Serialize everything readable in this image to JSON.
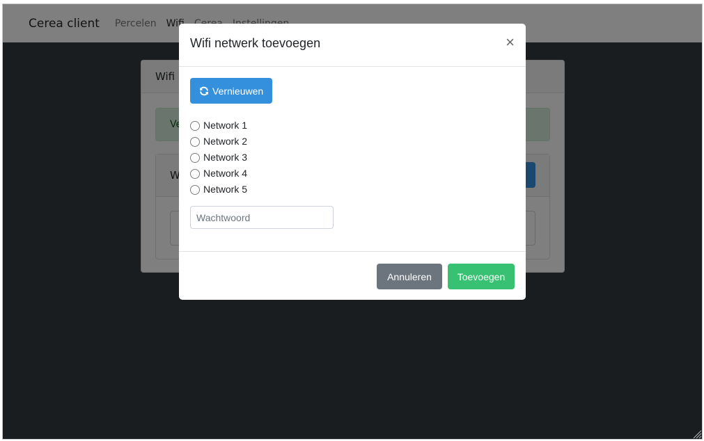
{
  "navbar": {
    "brand": "Cerea client",
    "links": [
      "Percelen",
      "Wifi",
      "Cerea",
      "Instellingen"
    ]
  },
  "background_page": {
    "card_title": "Wifi",
    "alert_text": "Ve",
    "inner_card_title": "W"
  },
  "modal": {
    "title": "Wifi netwerk toevoegen",
    "close_label": "×",
    "refresh_label": "Vernieuwen",
    "networks": [
      "Network 1",
      "Network 2",
      "Network 3",
      "Network 4",
      "Network 5"
    ],
    "password_placeholder": "Wachtwoord",
    "cancel_label": "Annuleren",
    "add_label": "Toevoegen"
  },
  "colors": {
    "primary": "#3490dc",
    "success": "#38c172",
    "secondary": "#6c757d"
  }
}
